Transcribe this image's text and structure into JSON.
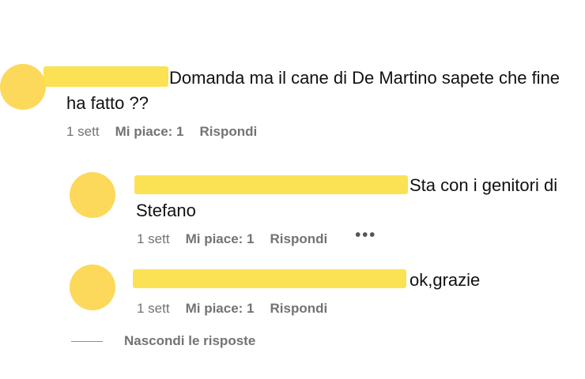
{
  "comments": [
    {
      "text_first_line": "Domanda ma il cane di De Martino sapete che fine",
      "text_second_line": "ha fatto ??",
      "time": "1 sett",
      "likes": "Mi piace: 1",
      "reply": "Rispondi"
    },
    {
      "text_first_line": "Sta con i genitori di",
      "text_second_line": "Stefano",
      "time": "1 sett",
      "likes": "Mi piace: 1",
      "reply": "Rispondi",
      "more": "•••"
    },
    {
      "text_first_line": "ok,grazie",
      "time": "1 sett",
      "likes": "Mi piace: 1",
      "reply": "Rispondi"
    }
  ],
  "hide_replies_label": "Nascondi le risposte",
  "colors": {
    "avatar": "#fcd95a",
    "redaction": "#fbe04c",
    "meta_text": "#737373"
  }
}
